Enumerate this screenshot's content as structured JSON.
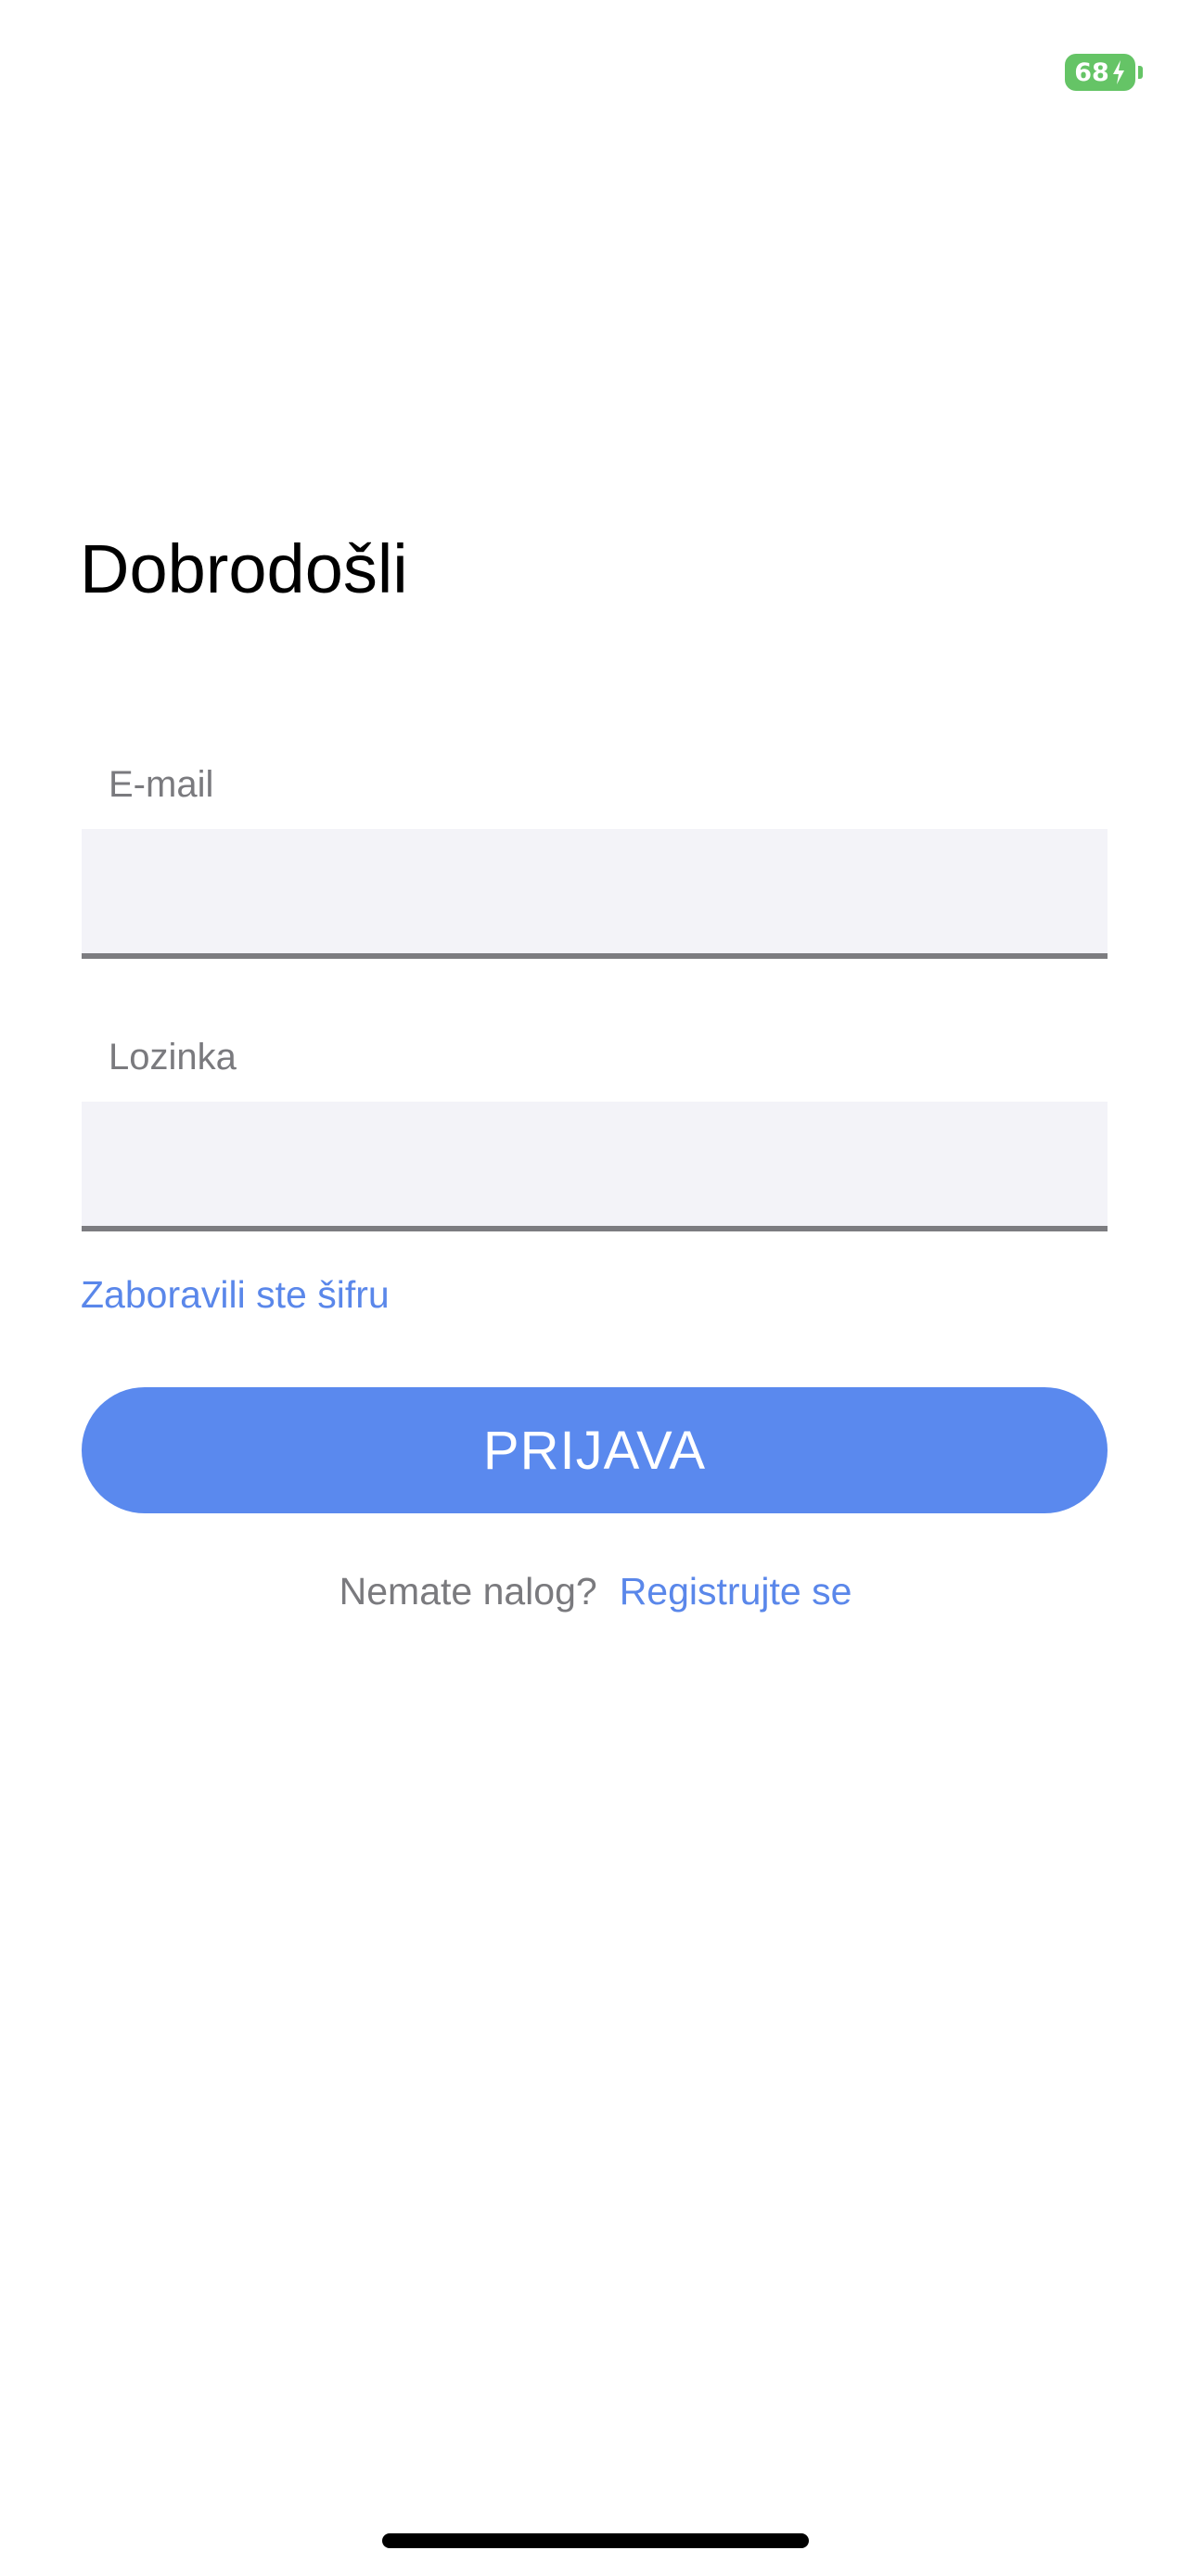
{
  "status_bar": {
    "battery_level": "68",
    "battery_icon": "battery-charging-icon",
    "battery_color": "#65c466"
  },
  "login": {
    "title": "Dobrodošli",
    "email_label": "E-mail",
    "email_value": "",
    "password_label": "Lozinka",
    "password_value": "",
    "forgot_password": "Zaboravili ste šifru",
    "submit_label": "PRIJAVA",
    "signup_prompt": "Nemate nalog?",
    "signup_link": "Registrujte se"
  },
  "colors": {
    "accent": "#5a89ee",
    "link": "#5a87ea",
    "field_background": "#f3f3f8",
    "label": "#7a7a7e"
  }
}
